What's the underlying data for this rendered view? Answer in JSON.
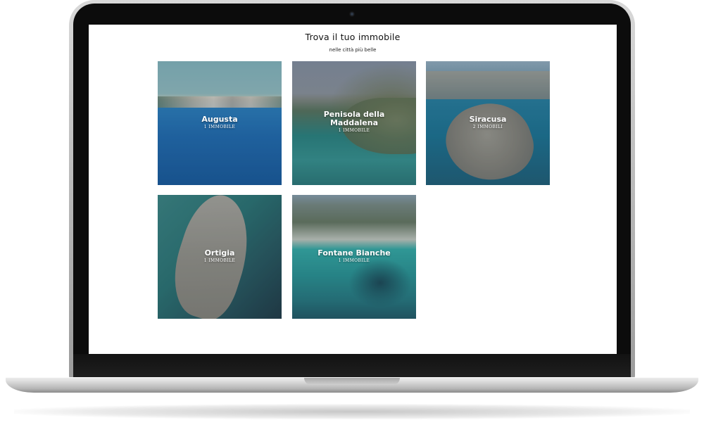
{
  "page": {
    "title": "Trova il tuo immobile",
    "subtitle": "nelle città più belle"
  },
  "cities": [
    {
      "name": "Augusta",
      "count": "1 IMMOBILE"
    },
    {
      "name": "Penisola della Maddalena",
      "count": "1 IMMOBILE"
    },
    {
      "name": "Siracusa",
      "count": "2 IMMOBILI"
    },
    {
      "name": "Ortigia",
      "count": "1 IMMOBILE"
    },
    {
      "name": "Fontane Bianche",
      "count": "1 IMMOBILE"
    }
  ],
  "colors": {
    "title_text": "#111111",
    "tile_text": "#ffffff",
    "laptop_bezel": "#0c0c0c",
    "laptop_aluminium": "#c8c8c8"
  },
  "icons": {
    "camera": "webcam-icon"
  }
}
